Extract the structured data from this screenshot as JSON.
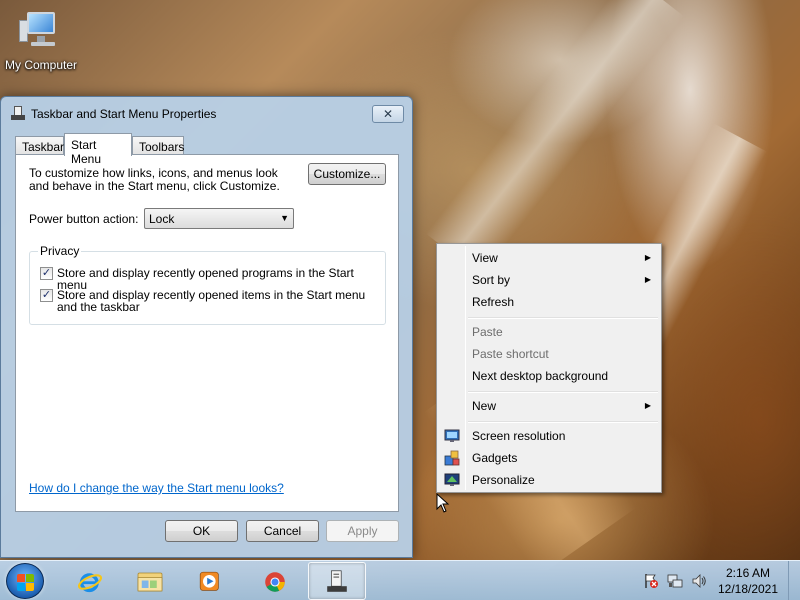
{
  "desktop": {
    "icons": [
      {
        "label": "My Computer",
        "icon": "my-computer-icon"
      }
    ]
  },
  "dialog": {
    "title": "Taskbar and Start Menu Properties",
    "close_glyph": "✕",
    "tabs": [
      {
        "label": "Taskbar",
        "active": false
      },
      {
        "label": "Start Menu",
        "active": true
      },
      {
        "label": "Toolbars",
        "active": false
      }
    ],
    "intro_text": "To customize how links, icons, and menus look and behave in the Start menu, click Customize.",
    "customize_label": "Customize...",
    "power_label": "Power button action:",
    "power_value": "Lock",
    "privacy": {
      "label": "Privacy",
      "items": [
        {
          "label": "Store and display recently opened programs in the Start menu",
          "checked": true
        },
        {
          "label": "Store and display recently opened items in the Start menu and the taskbar",
          "checked": true
        }
      ]
    },
    "help_link": "How do I change the way the Start menu looks?",
    "buttons": {
      "ok": "OK",
      "cancel": "Cancel",
      "apply": "Apply"
    }
  },
  "context_menu": {
    "items": [
      {
        "label": "View",
        "submenu": true,
        "enabled": true
      },
      {
        "label": "Sort by",
        "submenu": true,
        "enabled": true
      },
      {
        "label": "Refresh",
        "submenu": false,
        "enabled": true
      },
      {
        "label": "Paste",
        "submenu": false,
        "enabled": false
      },
      {
        "label": "Paste shortcut",
        "submenu": false,
        "enabled": false
      },
      {
        "label": "Next desktop background",
        "submenu": false,
        "enabled": true
      },
      {
        "label": "New",
        "submenu": true,
        "enabled": true
      },
      {
        "label": "Screen resolution",
        "submenu": false,
        "enabled": true,
        "icon": "screen-resolution-icon"
      },
      {
        "label": "Gadgets",
        "submenu": false,
        "enabled": true,
        "icon": "gadgets-icon"
      },
      {
        "label": "Personalize",
        "submenu": false,
        "enabled": true,
        "icon": "personalize-icon"
      }
    ],
    "submenu_glyph": "▶"
  },
  "taskbar": {
    "pinned": [
      "internet-explorer-icon",
      "windows-explorer-icon",
      "windows-media-player-icon",
      "google-chrome-icon",
      "taskbar-properties-icon"
    ],
    "active_app": "taskbar-properties-icon",
    "tray_icons": [
      "action-center-icon",
      "network-icon",
      "volume-icon"
    ],
    "time": "2:16 AM",
    "date": "12/18/2021"
  },
  "colors": {
    "link": "#0066cc",
    "window_frame": "#b8d2eb",
    "menu_bg": "#f0f0f0",
    "start_orb": "#1d5fb0"
  }
}
